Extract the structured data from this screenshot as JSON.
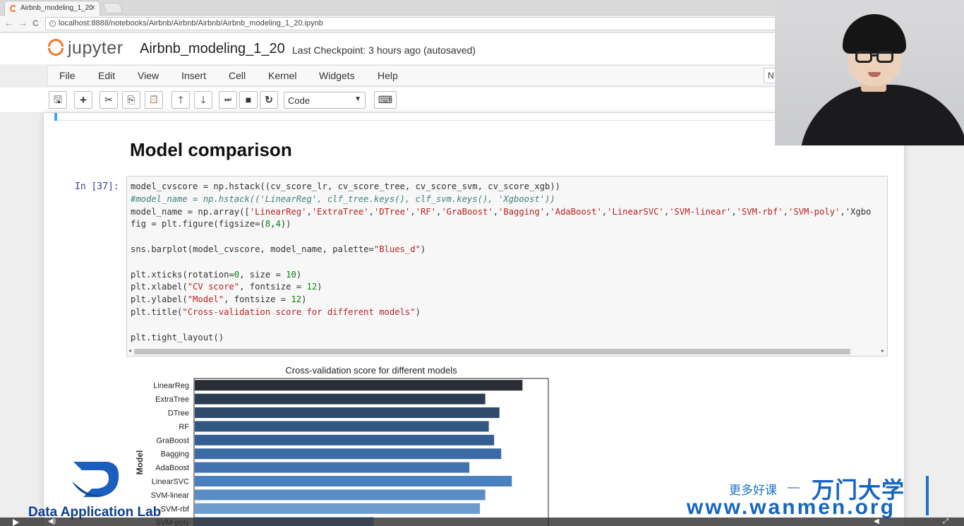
{
  "browser": {
    "tab_title": "Airbnb_modeling_1_20",
    "tab_close": "×",
    "url": "localhost:8888/notebooks/Airbnb/Airbnb/Airbnb/Airbnb_modeling_1_20.ipynb",
    "back": "←",
    "forward": "→",
    "reload": "C"
  },
  "jupyter": {
    "logo_text": "jupyter",
    "notebook_name": "Airbnb_modeling_1_20",
    "checkpoint": "Last Checkpoint: 3 hours ago (autosaved)",
    "kernel_indicator": "N",
    "menu": [
      "File",
      "Edit",
      "View",
      "Insert",
      "Cell",
      "Kernel",
      "Widgets",
      "Help"
    ],
    "toolbar": {
      "save": "🖫",
      "add": "+",
      "cut": "✂",
      "copy": "⎘",
      "paste": "📋",
      "up": "🡑",
      "down": "🡓",
      "run": "⏭",
      "stop": "■",
      "restart": "↻",
      "cell_type": "Code",
      "palette": "⌨"
    }
  },
  "notebook": {
    "heading": "Model comparison",
    "prompt": "In  [37]:",
    "code_lines": [
      "model_cvscore = np.hstack((cv_score_lr, cv_score_tree, cv_score_svm, cv_score_xgb))",
      "#model_name = np.hstack(('LinearReg', clf_tree.keys(), clf_svm.keys(), 'Xgboost'))",
      "model_name = np.array(['LinearReg','ExtraTree','DTree','RF','GraBoost','Bagging','AdaBoost','LinearSVC','SVM-linear','SVM-rbf','SVM-poly','Xgbo",
      "fig = plt.figure(figsize=(8,4))",
      "",
      "sns.barplot(model_cvscore, model_name, palette=\"Blues_d\")",
      "",
      "plt.xticks(rotation=0, size = 10)",
      "plt.xlabel(\"CV score\", fontsize = 12)",
      "plt.ylabel(\"Model\", fontsize = 12)",
      "plt.title(\"Cross-validation score for different models\")",
      "",
      "plt.tight_layout()"
    ]
  },
  "chart_data": {
    "type": "bar",
    "orientation": "horizontal",
    "title": "Cross-validation score for different models",
    "ylabel": "Model",
    "categories": [
      "LinearReg",
      "ExtraTree",
      "DTree",
      "RF",
      "GraBoost",
      "Bagging",
      "AdaBoost",
      "LinearSVC",
      "SVM-linear",
      "SVM-rbf",
      "SVM-poly"
    ],
    "values": [
      0.925,
      0.82,
      0.86,
      0.83,
      0.845,
      0.865,
      0.775,
      0.895,
      0.82,
      0.805,
      0.505
    ],
    "xlim": [
      0,
      1.0
    ],
    "colors": [
      "#2a2d33",
      "#2c3c52",
      "#2f4a6b",
      "#325783",
      "#355f94",
      "#3b6aa5",
      "#4173b1",
      "#4a80bd",
      "#5a8dc5",
      "#6c9cce",
      "#7faad6"
    ]
  },
  "overlays": {
    "dal_text": "Data Application Lab",
    "wm_cn": "更多好课",
    "wm_dash": "—",
    "wm_brand": "万门大学",
    "wm_url": "www.wanmen.org"
  }
}
